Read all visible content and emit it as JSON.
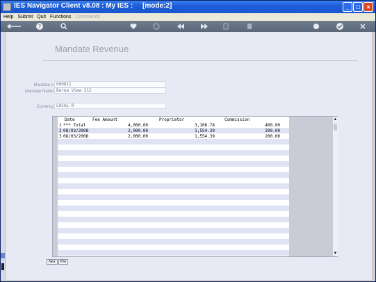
{
  "window": {
    "title": "IES Navigator Client v8.08 : My IES :     [mode:2]",
    "minimize": "_",
    "maximize": "□",
    "close": "×"
  },
  "menu": {
    "items": [
      "Help",
      "Submit",
      "Quit",
      "Functions"
    ],
    "disabled_item": "Commands"
  },
  "toolbar": {
    "icons": [
      "back-arrow-icon",
      "help-icon",
      "search-icon",
      "heart-icon",
      "refresh-icon",
      "rewind-icon",
      "fast-forward-icon",
      "first-icon",
      "last-icon",
      "print-icon",
      "ok-icon",
      "close-icon"
    ],
    "bg_color": "#67768a"
  },
  "form": {
    "title": "Mandate Revenue",
    "mandate_no_label": "Mandate #",
    "mandate_no_value": "000811",
    "mandate_name_label": "Mandate Name",
    "mandate_name_value": "Berea View 212",
    "currency_label": "Currency",
    "currency_value": "LOCAL R"
  },
  "grid": {
    "headers": {
      "date": "Date",
      "fee": "Fee Amount",
      "proprietor": "Proprietor",
      "commission": "Commission"
    },
    "rows": [
      {
        "num": "1",
        "date": "*** Total",
        "fee": "4,000.00",
        "proprietor": "3,108.78",
        "commission": "400.00"
      },
      {
        "num": "2",
        "date": "08/03/2008",
        "fee": "2,000.00",
        "proprietor": "1,554.39",
        "commission": "200.00"
      },
      {
        "num": "3",
        "date": "08/03/2008",
        "fee": "2,000.00",
        "proprietor": "1,554.39",
        "commission": "200.00"
      }
    ],
    "stripe_color": "#dfe3f3"
  },
  "nav": {
    "next": "Nex",
    "prev": "Pre"
  },
  "scroll": {
    "up": "▲",
    "down": "▼"
  }
}
